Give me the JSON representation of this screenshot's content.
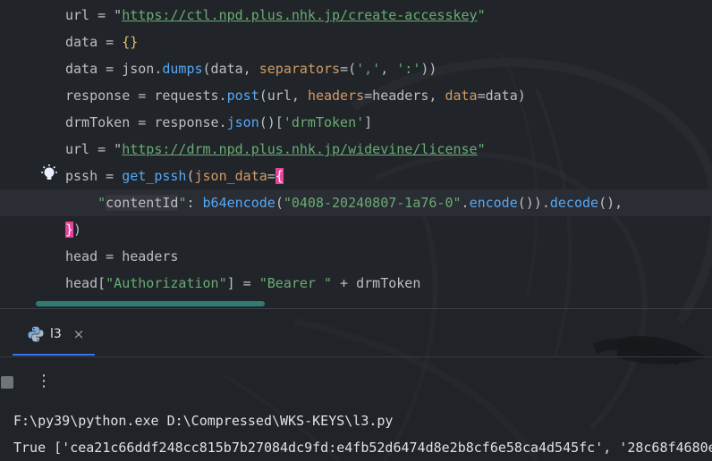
{
  "editor": {
    "lines": [
      {
        "parts": [
          [
            "url = \"",
            "p"
          ],
          [
            "https://ctl.npd.plus.nhk.jp/create-accesskey",
            "url"
          ],
          [
            "\"",
            "s"
          ]
        ]
      },
      {
        "parts": [
          [
            "data = ",
            "p"
          ],
          [
            "{}",
            "b"
          ]
        ]
      },
      {
        "parts": [
          [
            "data = json.",
            "p"
          ],
          [
            "dumps",
            "f"
          ],
          [
            "(data, ",
            "p"
          ],
          [
            "separators",
            "a"
          ],
          [
            "=(",
            "p"
          ],
          [
            "','",
            "s"
          ],
          [
            ", ",
            "p"
          ],
          [
            "':'",
            "s"
          ],
          [
            "))",
            "p"
          ]
        ]
      },
      {
        "parts": [
          [
            "response = requests.",
            "p"
          ],
          [
            "post",
            "f"
          ],
          [
            "(url, ",
            "p"
          ],
          [
            "headers",
            "a"
          ],
          [
            "=headers, ",
            "p"
          ],
          [
            "data",
            "a"
          ],
          [
            "=data)",
            "p"
          ]
        ]
      },
      {
        "parts": [
          [
            "drmToken = response.",
            "p"
          ],
          [
            "json",
            "f"
          ],
          [
            "()[",
            "p"
          ],
          [
            "'drmToken'",
            "s"
          ],
          [
            "]",
            "p"
          ]
        ]
      },
      {
        "parts": [
          [
            "url = \"",
            "p"
          ],
          [
            "https://drm.npd.plus.nhk.jp/widevine/license",
            "url"
          ],
          [
            "\"",
            "s"
          ]
        ]
      },
      {
        "parts": [
          [
            "pssh = ",
            "p"
          ],
          [
            "get_pssh",
            "f"
          ],
          [
            "(",
            "p"
          ],
          [
            "json_data",
            "a"
          ],
          [
            "=",
            "p"
          ],
          [
            "{",
            "hb"
          ]
        ]
      },
      {
        "parts": [
          [
            "    \"",
            "s"
          ],
          [
            "contentId",
            "hk"
          ],
          [
            "\"",
            "s"
          ],
          [
            ": ",
            "p"
          ],
          [
            "b64encode",
            "f"
          ],
          [
            "(",
            "p"
          ],
          [
            "\"0408-20240807-1a76-0\"",
            "s"
          ],
          [
            ".",
            "p"
          ],
          [
            "encode",
            "f"
          ],
          [
            "()).",
            "p"
          ],
          [
            "decode",
            "f"
          ],
          [
            "(),",
            "p"
          ]
        ]
      },
      {
        "parts": [
          [
            "}",
            "hb"
          ],
          [
            ")",
            "p"
          ]
        ]
      },
      {
        "parts": [
          [
            "head = headers",
            "p"
          ]
        ]
      },
      {
        "parts": [
          [
            "head[",
            "p"
          ],
          [
            "\"Authorization\"",
            "s"
          ],
          [
            "] = ",
            "p"
          ],
          [
            "\"Bearer \"",
            "s"
          ],
          [
            " + drmToken",
            "p"
          ]
        ]
      }
    ]
  },
  "run_panel": {
    "tab_label": "l3",
    "tab_icon": "python-icon",
    "close_glyph": "×",
    "more_glyph": "⋮",
    "console": [
      "F:\\py39\\python.exe D:\\Compressed\\WKS-KEYS\\l3.py",
      "True ['cea21c66ddf248cc815b7b27084dc9fd:e4fb52d6474d8e2b8cf6e58ca4d545fc', '28c68f4680e"
    ]
  },
  "colors": {
    "accent": "#3574f0",
    "brace_highlight": "#e8429a",
    "scrollbar": "#2f7c73"
  }
}
